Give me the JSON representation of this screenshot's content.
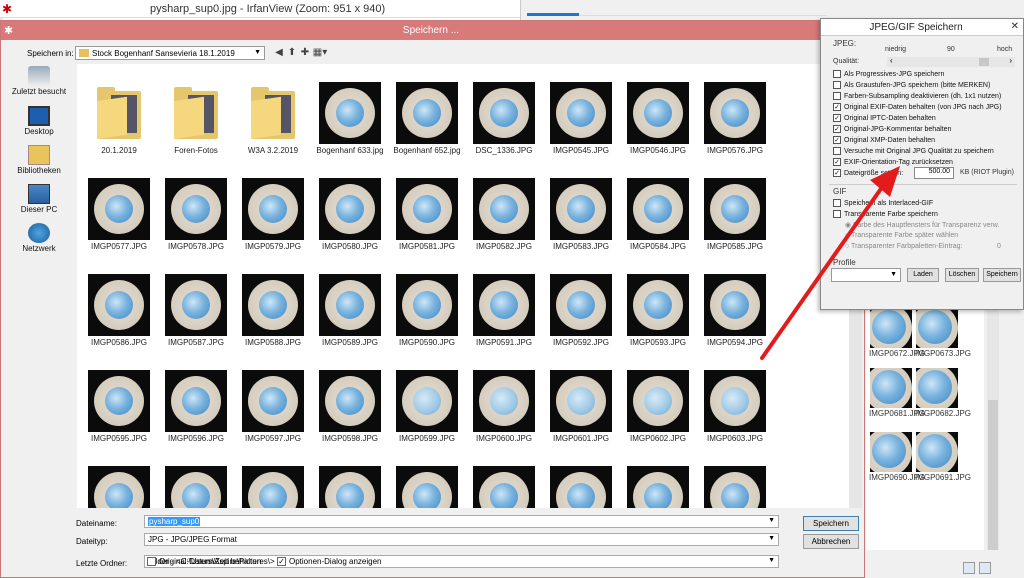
{
  "irfanview": {
    "title": "pysharp_sup0.jpg - IrfanView (Zoom: 951 x 940)"
  },
  "bg_window": {
    "thumbs": [
      {
        "label": "IMGP0672.JPG"
      },
      {
        "label": "IMGP0673.JPG"
      },
      {
        "label": "IMGP0681.JPG"
      },
      {
        "label": "IMGP0682.JPG"
      },
      {
        "label": "IMGP0690.JPG"
      },
      {
        "label": "IMGP0691.JPG"
      }
    ]
  },
  "dialog": {
    "title": "Speichern ...",
    "save_in_label": "Speichern in:",
    "save_in_value": "Stock Bogenhanf Sansevieria 18.1.2019",
    "places": [
      {
        "label": "Zuletzt besucht",
        "icon": "recent-places-icon"
      },
      {
        "label": "Desktop",
        "icon": "desktop-icon"
      },
      {
        "label": "Bibliotheken",
        "icon": "libraries-icon"
      },
      {
        "label": "Dieser PC",
        "icon": "this-pc-icon"
      },
      {
        "label": "Netzwerk",
        "icon": "network-icon"
      }
    ],
    "files": [
      {
        "name": "20.1.2019",
        "kind": "folder"
      },
      {
        "name": "Foren-Fotos",
        "kind": "folder"
      },
      {
        "name": "W3A 3.2.2019",
        "kind": "folder"
      },
      {
        "name": "Bogenhanf 633.jpg",
        "kind": "image"
      },
      {
        "name": "Bogenhanf 652.jpg",
        "kind": "image"
      },
      {
        "name": "DSC_1336.JPG",
        "kind": "image"
      },
      {
        "name": "IMGP0545.JPG",
        "kind": "image"
      },
      {
        "name": "IMGP0546.JPG",
        "kind": "image"
      },
      {
        "name": "IMGP0576.JPG",
        "kind": "image"
      },
      {
        "name": "IMGP0577.JPG",
        "kind": "image"
      },
      {
        "name": "IMGP0578.JPG",
        "kind": "image"
      },
      {
        "name": "IMGP0579.JPG",
        "kind": "image"
      },
      {
        "name": "IMGP0580.JPG",
        "kind": "image"
      },
      {
        "name": "IMGP0581.JPG",
        "kind": "image"
      },
      {
        "name": "IMGP0582.JPG",
        "kind": "image"
      },
      {
        "name": "IMGP0583.JPG",
        "kind": "image"
      },
      {
        "name": "IMGP0584.JPG",
        "kind": "image"
      },
      {
        "name": "IMGP0585.JPG",
        "kind": "image"
      },
      {
        "name": "IMGP0586.JPG",
        "kind": "image"
      },
      {
        "name": "IMGP0587.JPG",
        "kind": "image"
      },
      {
        "name": "IMGP0588.JPG",
        "kind": "image"
      },
      {
        "name": "IMGP0589.JPG",
        "kind": "image"
      },
      {
        "name": "IMGP0590.JPG",
        "kind": "image"
      },
      {
        "name": "IMGP0591.JPG",
        "kind": "image"
      },
      {
        "name": "IMGP0592.JPG",
        "kind": "image"
      },
      {
        "name": "IMGP0593.JPG",
        "kind": "image"
      },
      {
        "name": "IMGP0594.JPG",
        "kind": "image"
      },
      {
        "name": "IMGP0595.JPG",
        "kind": "image"
      },
      {
        "name": "IMGP0596.JPG",
        "kind": "image"
      },
      {
        "name": "IMGP0597.JPG",
        "kind": "image"
      },
      {
        "name": "IMGP0598.JPG",
        "kind": "image"
      },
      {
        "name": "IMGP0599.JPG",
        "kind": "image"
      },
      {
        "name": "IMGP0600.JPG",
        "kind": "image"
      },
      {
        "name": "IMGP0601.JPG",
        "kind": "image"
      },
      {
        "name": "IMGP0602.JPG",
        "kind": "image"
      },
      {
        "name": "IMGP0603.JPG",
        "kind": "image"
      }
    ],
    "filename_label": "Dateiname:",
    "filename_value": "pysharp_sup0",
    "filetype_label": "Dateityp:",
    "filetype_value": "JPG - JPG/JPEG Format",
    "recent_label": "Letzte Ordner:",
    "recent_value": "Hilder - <C:\\Users\\Aspire\\Pictures\\>",
    "save_button": "Speichern",
    "cancel_button": "Abbrechen",
    "keep_date_label": "Original-Datum/Zeit behalten",
    "keep_date_checked": false,
    "show_options_label": "Optionen-Dialog anzeigen",
    "show_options_checked": true
  },
  "options": {
    "title": "JPEG/GIF Speichern",
    "jpeg_label": "JPEG:",
    "quality_low": "niedrig",
    "quality_value": "90",
    "quality_high": "hoch",
    "quality_label": "Qualität:",
    "checks": [
      {
        "label": "Als Progressives-JPG speichern",
        "checked": false
      },
      {
        "label": "Als Graustufen-JPG speichern (bitte MERKEN)",
        "checked": false
      },
      {
        "label": "Farben-Subsampling deaktivieren (dh. 1x1 nutzen)",
        "checked": false
      },
      {
        "label": "Original EXIF-Daten behalten (von JPG nach JPG)",
        "checked": true
      },
      {
        "label": "Original IPTC-Daten behalten",
        "checked": true
      },
      {
        "label": "Original-JPG-Kommentar behalten",
        "checked": true
      },
      {
        "label": "Original XMP-Daten behalten",
        "checked": true
      },
      {
        "label": "Versuche mit Original JPG Qualität zu speichern",
        "checked": false
      },
      {
        "label": "EXIF-Orientation-Tag zurücksetzen",
        "checked": true
      }
    ],
    "filesize_label": "Dateigröße setzen:",
    "filesize_checked": true,
    "filesize_value": "500.00",
    "filesize_unit": "KB (RIOT Plugin)",
    "gif_label": "GIF",
    "gif_interlaced": "Speichern als Interlaced-GIF",
    "gif_transparent": "Transparente Farbe speichern",
    "gif_opt1": "Farbe des Hauptfensters für Transparenz verw.",
    "gif_opt2": "Transparente Farbe später wählen",
    "gif_opt3": "Transparenter Farbpaletten-Eintrag:",
    "gif_opt3_value": "0",
    "profile_label": "Profile",
    "load_button": "Laden",
    "delete_button": "Löschen",
    "save_button": "Speichern"
  }
}
